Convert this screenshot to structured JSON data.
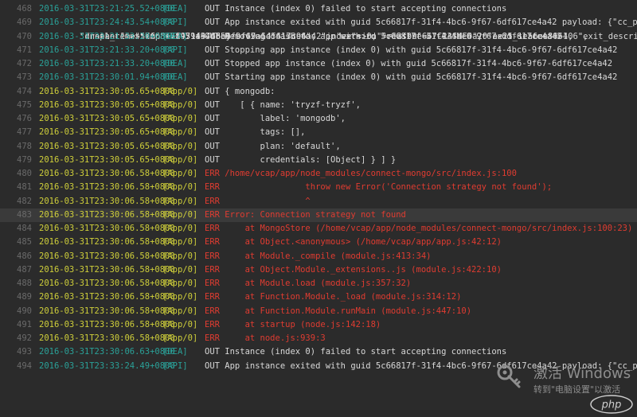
{
  "log": {
    "rows": [
      {
        "n": "468",
        "ts": "2016-03-31T23:21:25.52+0800",
        "src": "[DEA]",
        "msg": "OUT Instance (index 0) failed to start accepting connections",
        "type": "info"
      },
      {
        "n": "469",
        "ts": "2016-03-31T23:24:43.54+0800",
        "src": "[API]",
        "msg": "OUT App instance exited with guid 5c66817f-31f4-4bc6-9f67-6df617ce4a42 payload: {\"cc_partition\"=>\"d",
        "type": "info"
      },
      {
        "n": "",
        "cont": "\"droplet\"=>\"5c66817f-31f4-4bc6-9f67-6df617ce4a42\", \"version\"=>\"2f99e667-13f4-4a20-ae25-1e56ce886406\",",
        "type": "cont"
      },
      {
        "n": "",
        "cont": "\"instance\"=>\"7fc3e6b971a94d6e9fbf49a145413396\", \"index\"=>0, \"reason\"=>\"CRASHED\", \"exit_status\"=>1, \"exit_description\"=>\"app instance exi",
        "type": "cont"
      },
      {
        "n": "",
        "cont": "\"crash_timestamp\"=>1459437685}",
        "type": "cont"
      },
      {
        "n": "470",
        "ts": "2016-03-31T23:21:33.20+0800",
        "src": "[DEA]",
        "msg": "OUT Removing crash for app with id 5c66817f-31f4-4bc6-9f67-6df617ce4a42",
        "type": "info"
      },
      {
        "n": "471",
        "ts": "2016-03-31T23:21:33.20+0800",
        "src": "[API]",
        "msg": "OUT Stopping app instance (index 0) with guid 5c66817f-31f4-4bc6-9f67-6df617ce4a42",
        "type": "info"
      },
      {
        "n": "472",
        "ts": "2016-03-31T23:21:33.20+0800",
        "src": "[DEA]",
        "msg": "OUT Stopped app instance (index 0) with guid 5c66817f-31f4-4bc6-9f67-6df617ce4a42",
        "type": "info"
      },
      {
        "n": "473",
        "ts": "2016-03-31T23:30:01.94+0800",
        "src": "[DEA]",
        "msg": "OUT Starting app instance (index 0) with guid 5c66817f-31f4-4bc6-9f67-6df617ce4a42",
        "type": "info"
      },
      {
        "n": "474",
        "ts": "2016-03-31T23:30:05.65+0800",
        "src": "[App/0]",
        "msg": "OUT { mongodb:",
        "type": "out"
      },
      {
        "n": "475",
        "ts": "2016-03-31T23:30:05.65+0800",
        "src": "[App/0]",
        "msg": "OUT    [ { name: 'tryzf-tryzf',",
        "type": "out"
      },
      {
        "n": "476",
        "ts": "2016-03-31T23:30:05.65+0800",
        "src": "[App/0]",
        "msg": "OUT        label: 'mongodb',",
        "type": "out"
      },
      {
        "n": "477",
        "ts": "2016-03-31T23:30:05.65+0800",
        "src": "[App/0]",
        "msg": "OUT        tags: [],",
        "type": "out"
      },
      {
        "n": "478",
        "ts": "2016-03-31T23:30:05.65+0800",
        "src": "[App/0]",
        "msg": "OUT        plan: 'default',",
        "type": "out"
      },
      {
        "n": "479",
        "ts": "2016-03-31T23:30:05.65+0800",
        "src": "[App/0]",
        "msg": "OUT        credentials: [Object] } ] }",
        "type": "out"
      },
      {
        "n": "480",
        "ts": "2016-03-31T23:30:06.58+0800",
        "src": "[App/0]",
        "msg": "ERR /home/vcap/app/node_modules/connect-mongo/src/index.js:100",
        "type": "err"
      },
      {
        "n": "481",
        "ts": "2016-03-31T23:30:06.58+0800",
        "src": "[App/0]",
        "msg": "ERR                 throw new Error('Connection strategy not found');",
        "type": "err"
      },
      {
        "n": "482",
        "ts": "2016-03-31T23:30:06.58+0800",
        "src": "[App/0]",
        "msg": "ERR                 ^",
        "type": "err"
      },
      {
        "n": "483",
        "ts": "2016-03-31T23:30:06.58+0800",
        "src": "[App/0]",
        "msg": "ERR Error: Connection strategy not found",
        "type": "err",
        "hl": true
      },
      {
        "n": "484",
        "ts": "2016-03-31T23:30:06.58+0800",
        "src": "[App/0]",
        "msg": "ERR     at MongoStore (/home/vcap/app/node_modules/connect-mongo/src/index.js:100:23)",
        "type": "err"
      },
      {
        "n": "485",
        "ts": "2016-03-31T23:30:06.58+0800",
        "src": "[App/0]",
        "msg": "ERR     at Object.<anonymous> (/home/vcap/app/app.js:42:12)",
        "type": "err"
      },
      {
        "n": "486",
        "ts": "2016-03-31T23:30:06.58+0800",
        "src": "[App/0]",
        "msg": "ERR     at Module._compile (module.js:413:34)",
        "type": "err"
      },
      {
        "n": "487",
        "ts": "2016-03-31T23:30:06.58+0800",
        "src": "[App/0]",
        "msg": "ERR     at Object.Module._extensions..js (module.js:422:10)",
        "type": "err"
      },
      {
        "n": "488",
        "ts": "2016-03-31T23:30:06.58+0800",
        "src": "[App/0]",
        "msg": "ERR     at Module.load (module.js:357:32)",
        "type": "err"
      },
      {
        "n": "489",
        "ts": "2016-03-31T23:30:06.58+0800",
        "src": "[App/0]",
        "msg": "ERR     at Function.Module._load (module.js:314:12)",
        "type": "err"
      },
      {
        "n": "490",
        "ts": "2016-03-31T23:30:06.58+0800",
        "src": "[App/0]",
        "msg": "ERR     at Function.Module.runMain (module.js:447:10)",
        "type": "err"
      },
      {
        "n": "491",
        "ts": "2016-03-31T23:30:06.58+0800",
        "src": "[App/0]",
        "msg": "ERR     at startup (node.js:142:18)",
        "type": "err"
      },
      {
        "n": "492",
        "ts": "2016-03-31T23:30:06.58+0800",
        "src": "[App/0]",
        "msg": "ERR     at node.js:939:3",
        "type": "err"
      },
      {
        "n": "493",
        "ts": "2016-03-31T23:30:06.63+0800",
        "src": "[DEA]",
        "msg": "OUT Instance (index 0) failed to start accepting connections",
        "type": "info"
      },
      {
        "n": "494",
        "ts": "2016-03-31T23:33:24.49+0800",
        "src": "[API]",
        "msg": "OUT App instance exited with guid 5c66817f-31f4-4bc6-9f67-6df617ce4a42 payload: {\"cc_partition\"=>\"d",
        "type": "info"
      }
    ]
  },
  "watermark": {
    "title": "激活 Windows",
    "subtitle": "转到\"电脑设置\"以激活",
    "icon": "key-icon"
  },
  "logo": {
    "text": "php",
    "icon": "php-logo"
  },
  "colors": {
    "background": "#2b2b2b",
    "timestamp_system": "#2aa198",
    "timestamp_app": "#cfcf3a",
    "text": "#d8d8d8",
    "error": "#e03c31",
    "line_number": "#6a6a6a"
  }
}
